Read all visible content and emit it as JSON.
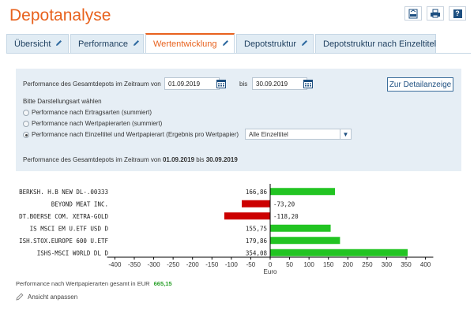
{
  "page": {
    "title": "Depotanalyse"
  },
  "toolbar": {
    "icons": [
      "csv-export-icon",
      "print-icon",
      "help-icon"
    ],
    "help_label": "?"
  },
  "tabs": [
    {
      "label": "Übersicht",
      "active": false
    },
    {
      "label": "Performance",
      "active": false
    },
    {
      "label": "Wertentwicklung",
      "active": true
    },
    {
      "label": "Depotstruktur",
      "active": false
    },
    {
      "label": "Depotstruktur nach Einzeltitel",
      "active": false
    }
  ],
  "filter": {
    "period_label": "Performance des Gesamtdepots im Zeitraum von",
    "from_date": "01.09.2019",
    "to_label": "bis",
    "to_date": "30.09.2019",
    "detail_button": "Zur Detailanzeige",
    "mode_label": "Bitte Darstellungsart wählen",
    "options": [
      {
        "label": "Performance nach Ertragsarten (summiert)",
        "selected": false
      },
      {
        "label": "Performance nach Wertpapierarten (summiert)",
        "selected": false
      },
      {
        "label": "Performance nach Einzeltitel und Wertpapierart (Ergebnis pro Wertpapier)",
        "selected": true
      }
    ],
    "select_value": "Alle Einzeltitel",
    "summary_prefix": "Performance des Gesamtdepots im Zeitraum von",
    "summary_from": "01.09.2019",
    "summary_mid": "bis",
    "summary_to": "30.09.2019"
  },
  "chart_data": {
    "type": "bar",
    "orientation": "horizontal",
    "categories": [
      "BERKSH. H.B NEW DL-.00333",
      "BEYOND MEAT INC.",
      "DT.BOERSE COM. XETRA-GOLD",
      "IS MSCI EM U.ETF USD D",
      "ISH.STOX.EUROPE 600 U.ETF",
      "ISHS-MSCI WORLD DL D"
    ],
    "values": [
      166.86,
      -73.2,
      -118.2,
      155.75,
      179.86,
      354.08
    ],
    "value_labels": [
      "166,86",
      "-73,20",
      "-118,20",
      "155,75",
      "179,86",
      "354,08"
    ],
    "xlabel": "Euro",
    "xlim": [
      -420,
      420
    ],
    "xticks": [
      -400,
      -350,
      -300,
      -250,
      -200,
      -150,
      -100,
      -50,
      0,
      50,
      100,
      150,
      200,
      250,
      300,
      350,
      400
    ],
    "colors": {
      "positive": "#22c422",
      "negative": "#cc0000"
    },
    "grid": false
  },
  "total": {
    "label": "Performance nach Wertpapierarten gesamt in EUR",
    "value": "665,15"
  },
  "adjust": {
    "label": "Ansicht anpassen"
  }
}
